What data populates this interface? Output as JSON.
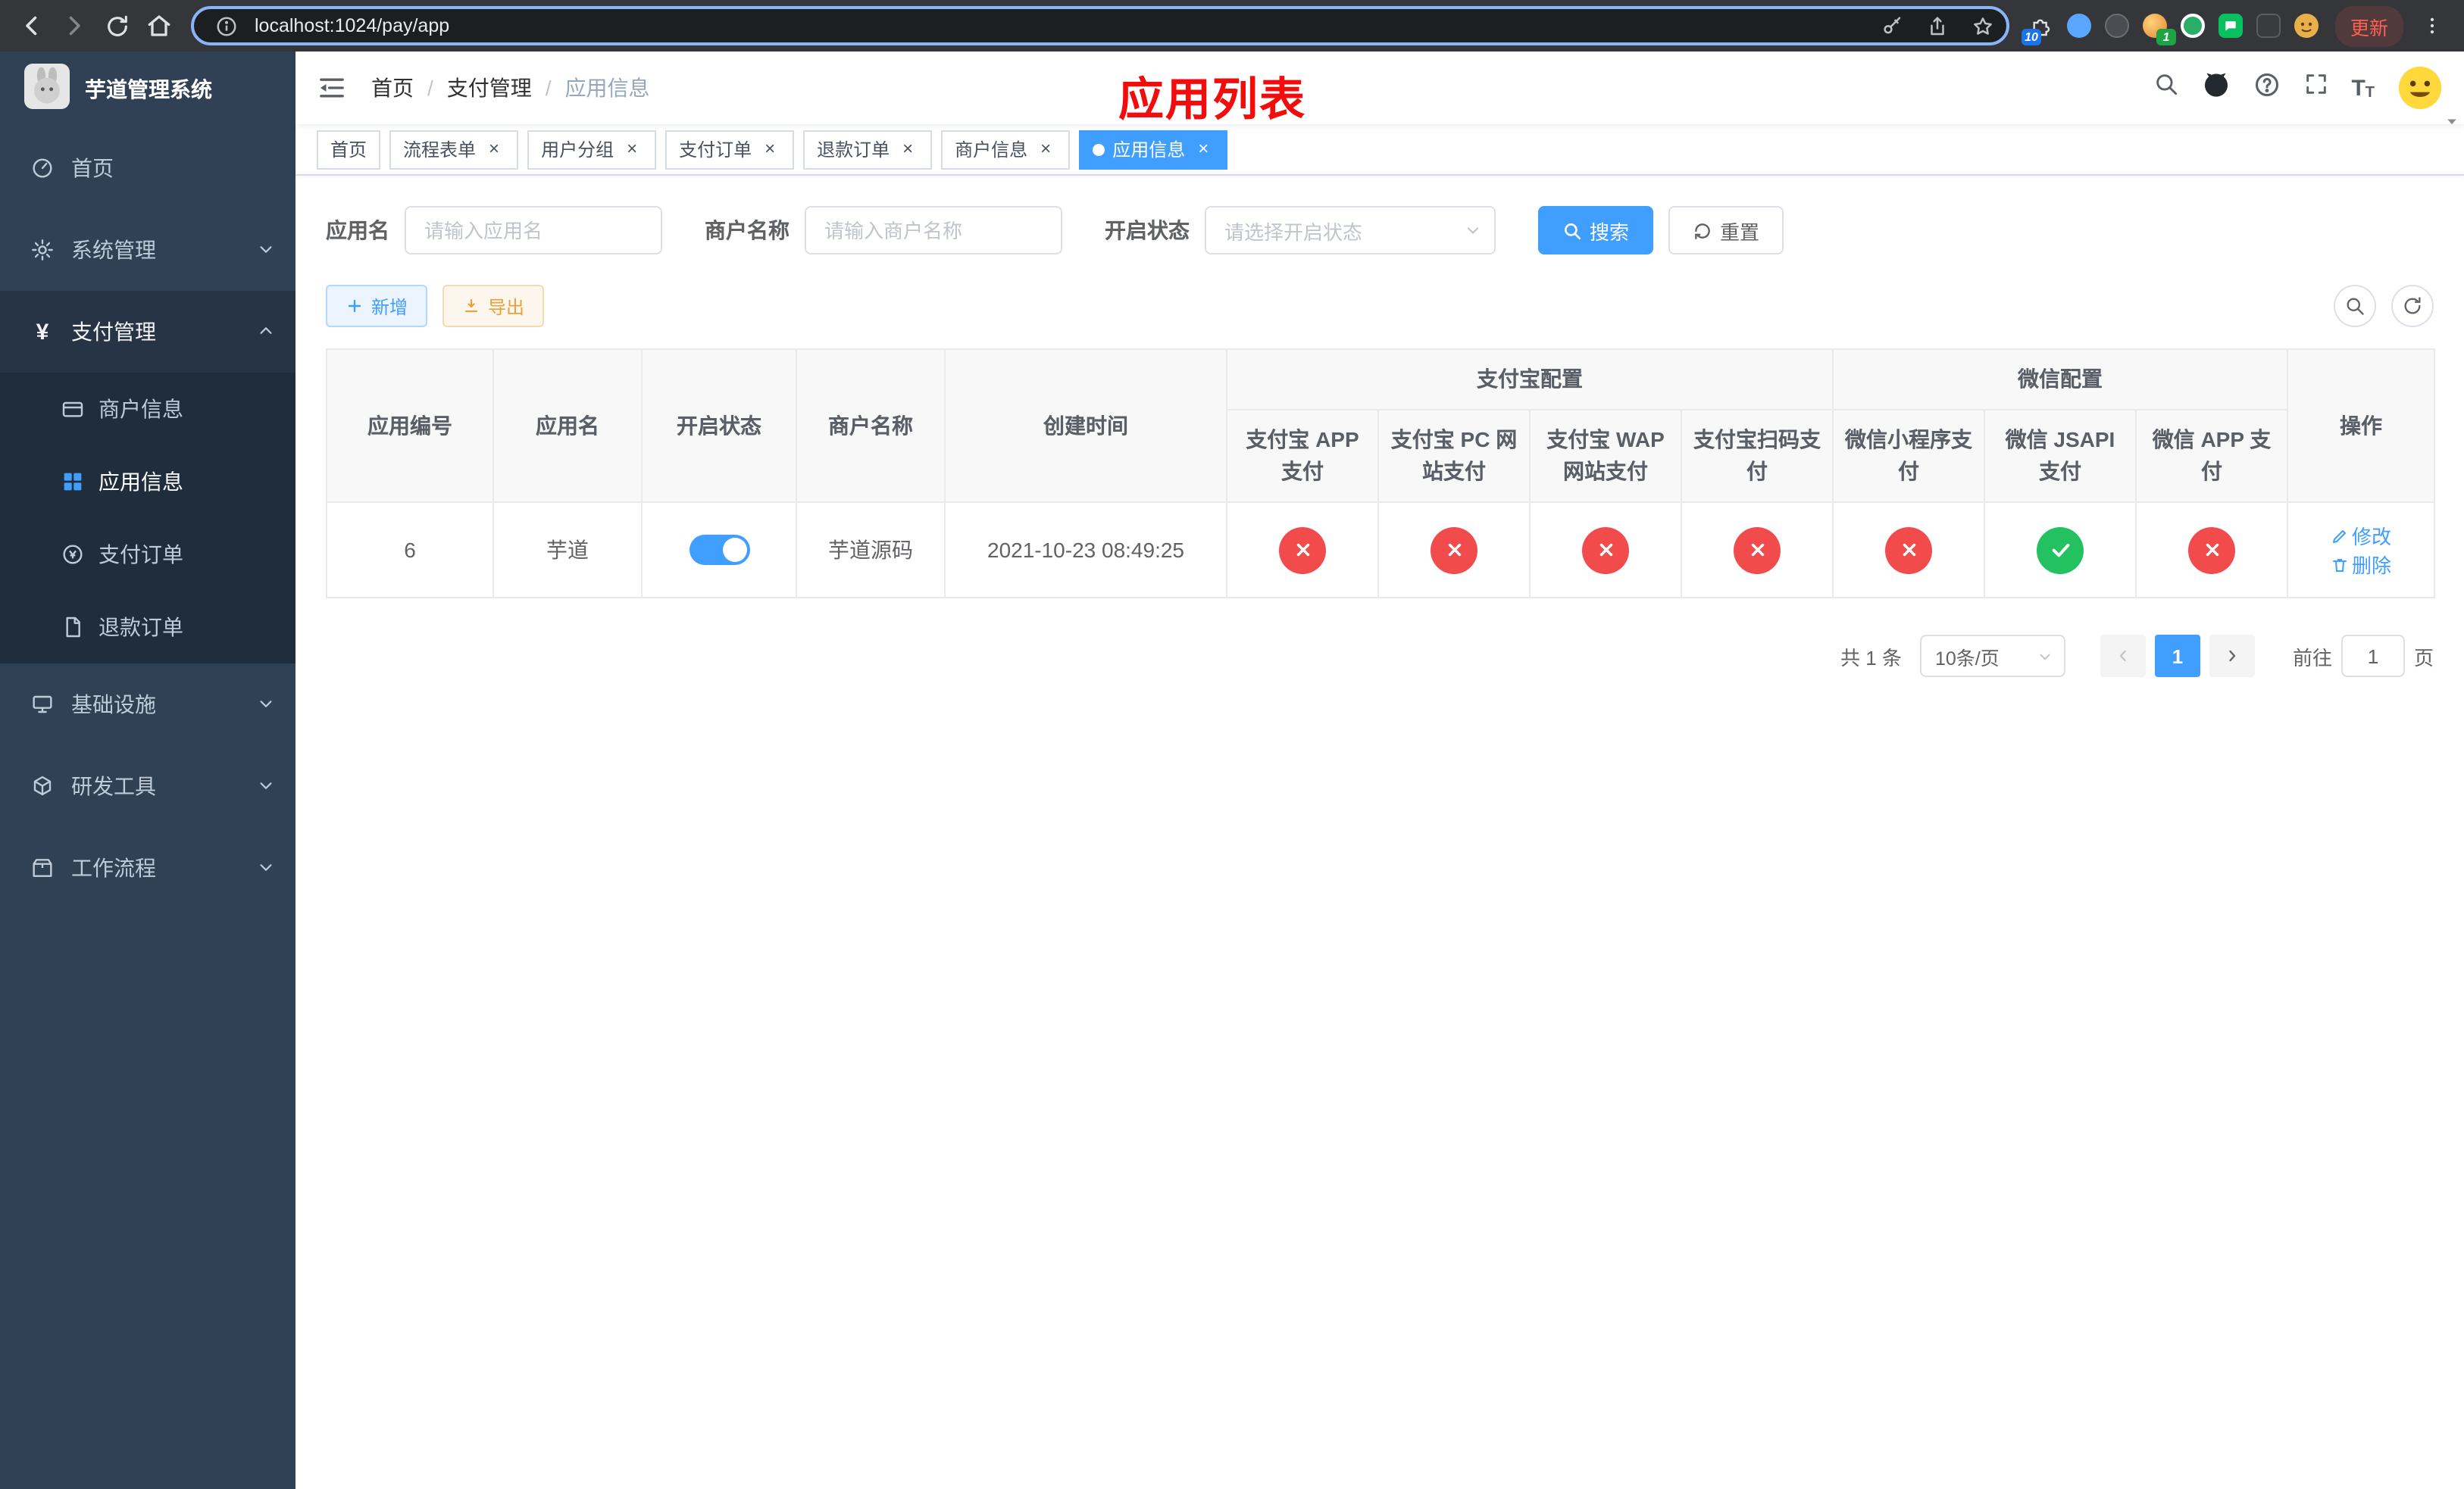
{
  "browser": {
    "url": "localhost:1024/pay/app",
    "update_label": "更新",
    "extension_badge_count": "10",
    "profile_badge_count": "1"
  },
  "annotation": {
    "title": "应用列表"
  },
  "sidebar": {
    "app_title": "芋道管理系统",
    "menu": [
      {
        "label": "首页"
      },
      {
        "label": "系统管理"
      },
      {
        "label": "支付管理",
        "children": [
          {
            "label": "商户信息"
          },
          {
            "label": "应用信息"
          },
          {
            "label": "支付订单"
          },
          {
            "label": "退款订单"
          }
        ]
      },
      {
        "label": "基础设施"
      },
      {
        "label": "研发工具"
      },
      {
        "label": "工作流程"
      }
    ]
  },
  "breadcrumb": {
    "items": [
      "首页",
      "支付管理",
      "应用信息"
    ]
  },
  "tabs": [
    {
      "label": "首页"
    },
    {
      "label": "流程表单"
    },
    {
      "label": "用户分组"
    },
    {
      "label": "支付订单"
    },
    {
      "label": "退款订单"
    },
    {
      "label": "商户信息"
    },
    {
      "label": "应用信息"
    }
  ],
  "filters": {
    "app_name_label": "应用名",
    "app_name_placeholder": "请输入应用名",
    "merchant_label": "商户名称",
    "merchant_placeholder": "请输入商户名称",
    "status_label": "开启状态",
    "status_placeholder": "请选择开启状态",
    "search_label": "搜索",
    "reset_label": "重置"
  },
  "toolbar": {
    "add_label": "新增",
    "export_label": "导出"
  },
  "table": {
    "groups": {
      "alipay": "支付宝配置",
      "wechat": "微信配置"
    },
    "columns": {
      "app_id": "应用编号",
      "app_name": "应用名",
      "status": "开启状态",
      "merchant": "商户名称",
      "created": "创建时间",
      "alipay_app": "支付宝 APP 支付",
      "alipay_pc": "支付宝 PC 网站支付",
      "alipay_wap": "支付宝 WAP 网站支付",
      "alipay_scan": "支付宝扫码支付",
      "wechat_mini": "微信小程序支付",
      "wechat_jsapi": "微信 JSAPI 支付",
      "wechat_app": "微信 APP 支付",
      "actions": "操作"
    },
    "rows": [
      {
        "app_id": "6",
        "app_name": "芋道",
        "status_on": true,
        "merchant": "芋道源码",
        "created": "2021-10-23 08:49:25",
        "configs": [
          false,
          false,
          false,
          false,
          false,
          true,
          false
        ]
      }
    ],
    "row_actions": {
      "edit": "修改",
      "delete": "删除"
    }
  },
  "pagination": {
    "total": "共 1 条",
    "page_size": "10条/页",
    "page": "1",
    "goto_label": "前往",
    "goto_value": "1",
    "unit_label": "页"
  },
  "colors": {
    "primary": "#409eff",
    "danger_circle": "#f24b4b",
    "success_circle": "#23c160",
    "sidebar_bg": "#304156",
    "sidebar_sub_bg": "#1f2d3d",
    "annotation_red": "#f20c0c"
  },
  "icons": {
    "back": "chevron-left",
    "forward": "chevron-right",
    "reload": "circular-arrow",
    "home": "house",
    "page-info": "info-circle",
    "password-key": "key",
    "share": "box-arrow-up",
    "bookmark": "star",
    "browser-menu": "vertical-dots",
    "menu-fold": "hamburger-lines",
    "navbar-search": "magnifier",
    "github": "octocat-circle",
    "help": "question-circle",
    "fullscreen": "expand-corners",
    "font-size": "T",
    "tab-close": "x",
    "select-caret": "chevron-down",
    "add": "plus",
    "export": "download-arrow",
    "refresh": "circular-arrows",
    "enabled": "check-circle",
    "disabled": "x-circle",
    "edit": "pencil",
    "delete": "trash"
  }
}
